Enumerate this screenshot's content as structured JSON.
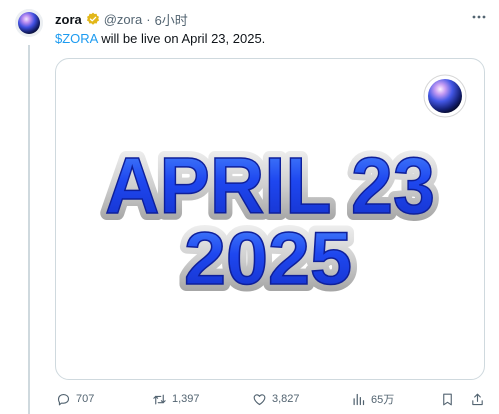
{
  "tweet": {
    "display_name": "zora",
    "handle": "@zora",
    "dot": "·",
    "time": "6小时",
    "text_cashtag": "$ZORA",
    "text_rest": " will be live on April 23, 2025.",
    "media": {
      "line1": "APRIL 23",
      "line2": "2025"
    },
    "stats": {
      "replies": "707",
      "reposts": "1,397",
      "likes": "3,827",
      "views": "65万"
    }
  },
  "icons": {
    "verified": "verified-badge-icon",
    "more": "more-options-icon",
    "reply": "reply-icon",
    "repost": "repost-icon",
    "like": "heart-icon",
    "views": "views-bar-chart-icon",
    "bookmark": "bookmark-icon",
    "share": "share-icon"
  },
  "colors": {
    "accent": "#1d9bf0",
    "verified_gold": "#e2b719",
    "headline_blue": "#1f3fe0",
    "muted": "#536471"
  }
}
